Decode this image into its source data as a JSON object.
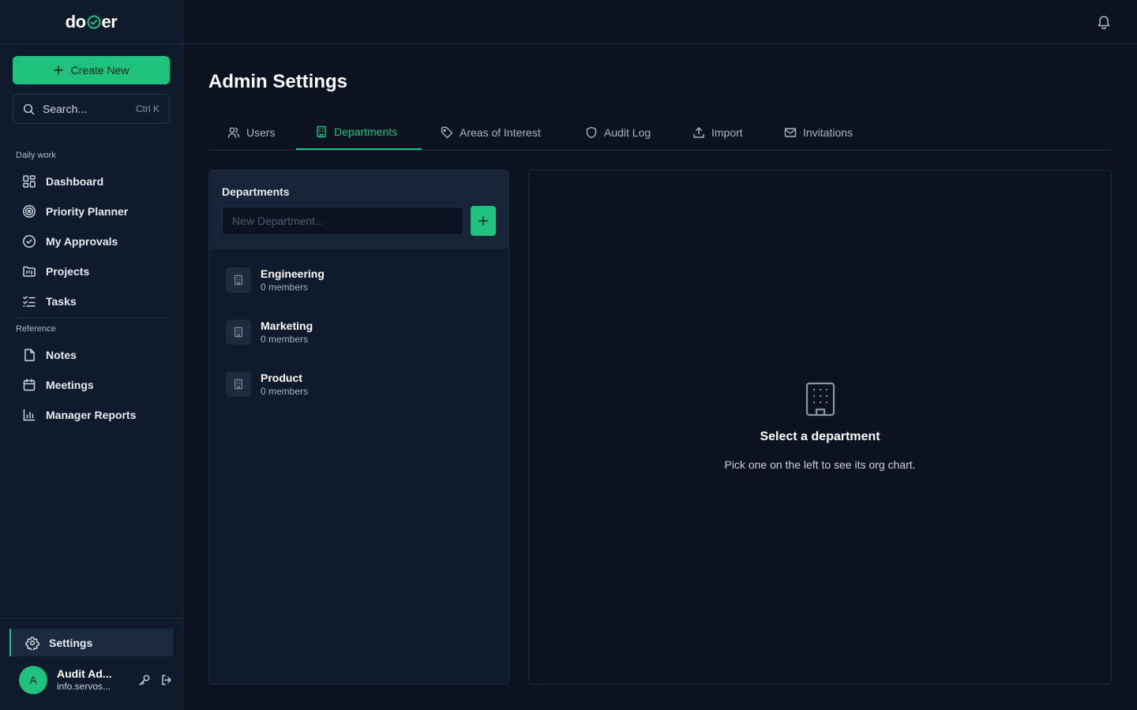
{
  "brand": {
    "logo_left": "do",
    "logo_right": "er",
    "accent": "#1ec27c"
  },
  "sidebar": {
    "create_label": "Create New",
    "search": {
      "placeholder": "Search...",
      "shortcut": "Ctrl K"
    },
    "sections": [
      {
        "label": "Daily work"
      },
      {
        "label": "Reference"
      }
    ],
    "items": [
      {
        "label": "Dashboard",
        "icon": "grid-icon"
      },
      {
        "label": "Priority Planner",
        "icon": "target-icon"
      },
      {
        "label": "My Approvals",
        "icon": "check-circle-icon"
      },
      {
        "label": "Projects",
        "icon": "folder-kanban-icon"
      },
      {
        "label": "Tasks",
        "icon": "list-checks-icon"
      },
      {
        "label": "Notes",
        "icon": "file-icon"
      },
      {
        "label": "Meetings",
        "icon": "calendar-icon"
      },
      {
        "label": "Manager Reports",
        "icon": "bar-chart-icon"
      }
    ],
    "settings_label": "Settings",
    "user": {
      "initial": "A",
      "name": "Audit Ad...",
      "email": "info.servos..."
    }
  },
  "page": {
    "title": "Admin Settings",
    "tabs": [
      {
        "label": "Users",
        "icon": "users-icon",
        "active": false
      },
      {
        "label": "Departments",
        "icon": "building-icon",
        "active": true
      },
      {
        "label": "Areas of Interest",
        "icon": "tag-icon",
        "active": false
      },
      {
        "label": "Audit Log",
        "icon": "shield-icon",
        "active": false
      },
      {
        "label": "Import",
        "icon": "upload-icon",
        "active": false
      },
      {
        "label": "Invitations",
        "icon": "mail-icon",
        "active": false
      }
    ]
  },
  "departments": {
    "title": "Departments",
    "input_placeholder": "New Department...",
    "items": [
      {
        "name": "Engineering",
        "members": "0 members"
      },
      {
        "name": "Marketing",
        "members": "0 members"
      },
      {
        "name": "Product",
        "members": "0 members"
      }
    ]
  },
  "empty_state": {
    "title": "Select a department",
    "subtitle": "Pick one on the left to see its org chart."
  }
}
